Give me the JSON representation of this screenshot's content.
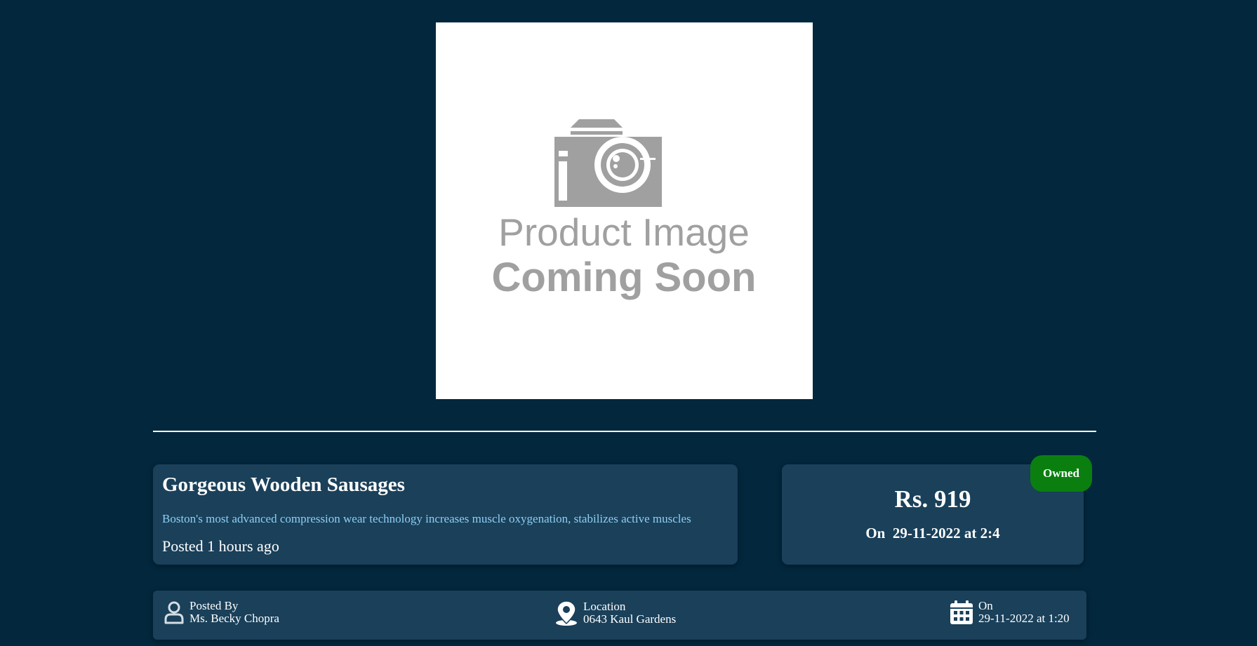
{
  "product": {
    "image_text": {
      "line1": "Product Image",
      "line2": "Coming Soon"
    },
    "title": "Gorgeous Wooden Sausages",
    "description": "Boston's most advanced compression wear technology increases muscle oxygenation, stabilizes active muscles",
    "posted": "Posted 1 hours ago"
  },
  "pricing": {
    "price": "Rs. 919",
    "date": "On  29-11-2022 at 2:4",
    "status": "Owned"
  },
  "meta": {
    "posted_by_label": "Posted By",
    "posted_by_value": "Ms. Becky Chopra",
    "location_label": "Location",
    "location_value": "0643 Kaul Gardens",
    "date_label": "On",
    "date_value": "29-11-2022 at 1:20"
  },
  "icons": {
    "camera": "camera-icon",
    "user": "user-icon",
    "location": "map-pin-icon",
    "calendar": "calendar-icon"
  },
  "colors": {
    "background": "#03273d",
    "card": "#1a405a",
    "description": "#8ecff3",
    "badge": "#0a7f10",
    "placeholder_gray": "#a0a0a0"
  }
}
